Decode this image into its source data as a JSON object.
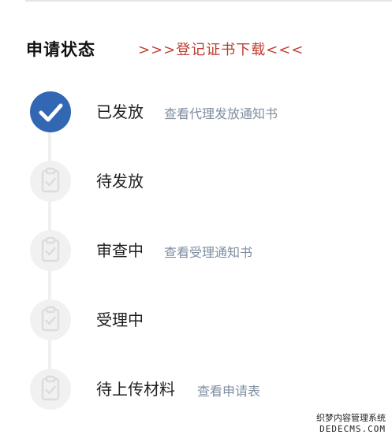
{
  "header": {
    "title": "申请状态",
    "download_link": ">>>登记证书下载<<<"
  },
  "steps": [
    {
      "label": "已发放",
      "link": "查看代理发放通知书",
      "status": "completed",
      "icon": "check-icon"
    },
    {
      "label": "待发放",
      "link": "",
      "status": "pending",
      "icon": "clipboard-check-icon"
    },
    {
      "label": "审查中",
      "link": "查看受理通知书",
      "status": "pending",
      "icon": "clipboard-check-icon"
    },
    {
      "label": "受理中",
      "link": "",
      "status": "pending",
      "icon": "clipboard-check-icon"
    },
    {
      "label": "待上传材料",
      "link": "查看申请表",
      "status": "pending",
      "icon": "clipboard-check-icon"
    }
  ],
  "watermark": {
    "line1": "织梦内容管理系统",
    "line2": "DEDECMS.COM"
  },
  "colors": {
    "accent_blue": "#3267b4",
    "link_red": "#c0392b",
    "link_gray": "#7f8ea2",
    "pending_icon_bg": "#f1f1f1"
  }
}
